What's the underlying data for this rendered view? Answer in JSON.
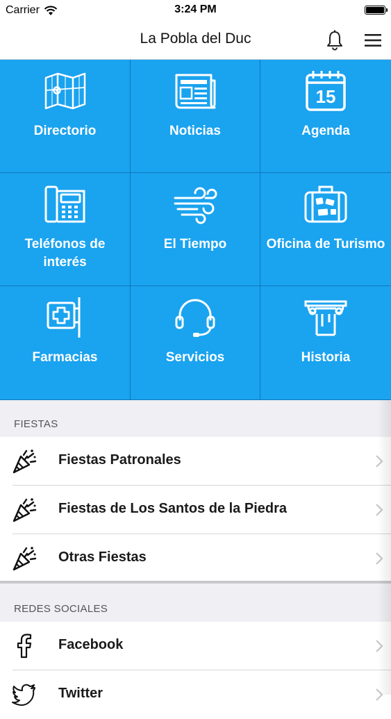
{
  "status_bar": {
    "carrier": "Carrier",
    "time": "3:24 PM",
    "wifi_icon": "wifi-icon",
    "battery_icon": "battery-icon"
  },
  "nav": {
    "title": "La Pobla del Duc",
    "bell_icon": "bell-icon",
    "menu_icon": "hamburger-menu-icon"
  },
  "grid": {
    "background_color": "#1aa3ef",
    "tiles": [
      {
        "label": "Directorio",
        "icon": "map-icon"
      },
      {
        "label": "Noticias",
        "icon": "newspaper-icon"
      },
      {
        "label": "Agenda",
        "icon": "calendar-icon",
        "icon_text": "15"
      },
      {
        "label": "Teléfonos de interés",
        "icon": "phone-icon"
      },
      {
        "label": "El Tiempo",
        "icon": "wind-icon"
      },
      {
        "label": "Oficina de Turismo",
        "icon": "suitcase-icon"
      },
      {
        "label": "Farmacias",
        "icon": "pharmacy-sign-icon"
      },
      {
        "label": "Servicios",
        "icon": "headset-icon"
      },
      {
        "label": "Historia",
        "icon": "column-icon"
      }
    ]
  },
  "sections": [
    {
      "header": "FIESTAS",
      "rows": [
        {
          "label": "Fiestas Patronales",
          "icon": "party-popper-icon"
        },
        {
          "label": "Fiestas de Los Santos de la Piedra",
          "icon": "party-popper-icon"
        },
        {
          "label": "Otras Fiestas",
          "icon": "party-popper-icon"
        }
      ]
    },
    {
      "header": "REDES SOCIALES",
      "rows": [
        {
          "label": "Facebook",
          "icon": "facebook-icon"
        },
        {
          "label": "Twitter",
          "icon": "twitter-icon"
        }
      ]
    }
  ]
}
